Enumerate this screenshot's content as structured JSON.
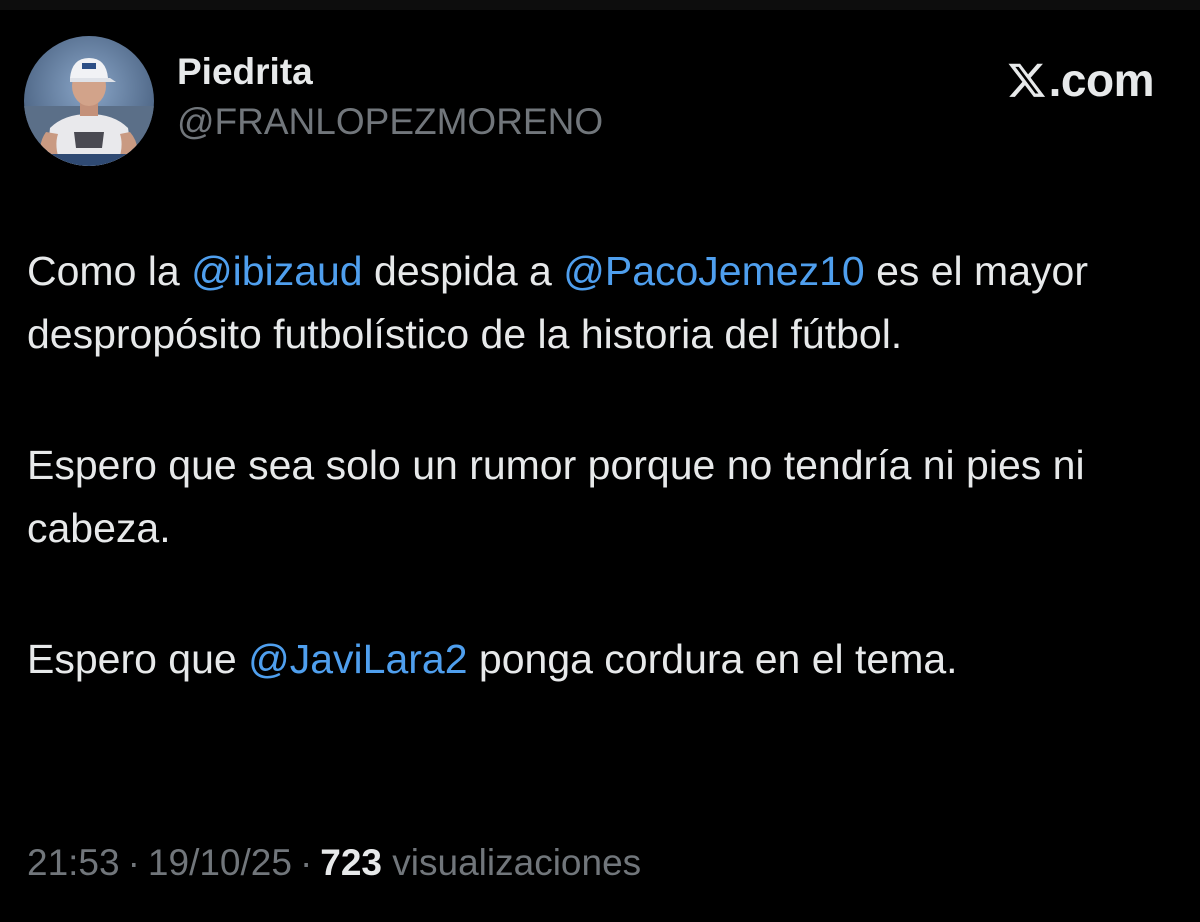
{
  "window": {
    "top_strip_color": "#0d0d0d",
    "background": "#000000"
  },
  "author": {
    "display_name": "Piedrita",
    "handle": "@FRANLOPEZMORENO",
    "avatar_icon": "profile-photo"
  },
  "brand": {
    "icon": "x-logo-icon",
    "text": "X.com",
    "text_suffix": ".com"
  },
  "tweet": {
    "paragraphs": [
      [
        {
          "text": "Como la ",
          "mention": false
        },
        {
          "text": "@ibizaud",
          "mention": true
        },
        {
          "text": " despida a ",
          "mention": false
        },
        {
          "text": "@PacoJemez10",
          "mention": true
        },
        {
          "text": " es el mayor despropósito futbolístico de la historia del fútbol.",
          "mention": false
        }
      ],
      [
        {
          "text": "Espero que sea solo un rumor porque no tendría ni pies ni cabeza.",
          "mention": false
        }
      ],
      [
        {
          "text": "Espero que ",
          "mention": false
        },
        {
          "text": "@JaviLara2",
          "mention": true
        },
        {
          "text": " ponga cordura en el tema.",
          "mention": false
        }
      ]
    ]
  },
  "meta": {
    "time": "21:53",
    "separator": "·",
    "date": "19/10/25",
    "views_count": "723",
    "views_label": "visualizaciones"
  },
  "colors": {
    "text_primary": "#e7e9ea",
    "text_secondary": "#71767b",
    "mention": "#4f9fee"
  }
}
